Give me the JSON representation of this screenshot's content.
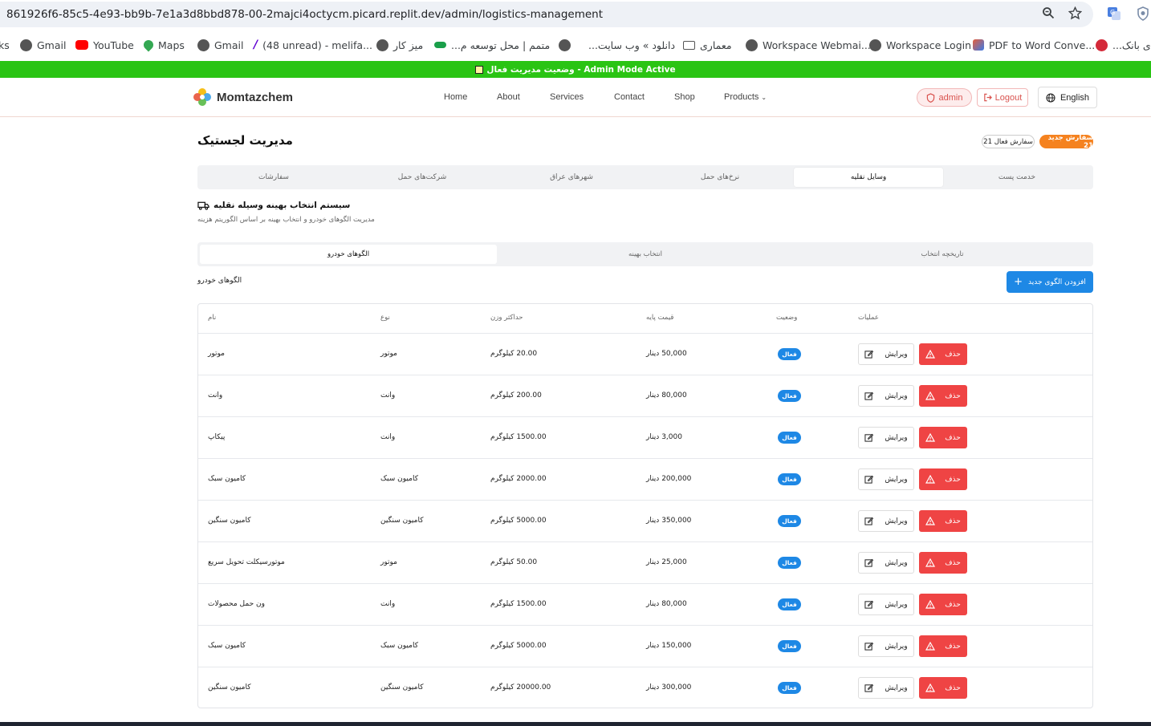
{
  "browser": {
    "url": "861926f6-85c5-4e93-bb9b-7e1a3d8bbd878-00-2majci4octycm.picard.replit.dev/admin/logistics-management",
    "bookmarks": [
      {
        "label": "ks",
        "icon": "none"
      },
      {
        "label": "Gmail",
        "icon": "globe-icon"
      },
      {
        "label": "YouTube",
        "icon": "youtube-icon"
      },
      {
        "label": "Maps",
        "icon": "maps-pin-icon"
      },
      {
        "label": "Gmail",
        "icon": "globe-icon"
      },
      {
        "label": "(48 unread) - melifa...",
        "icon": "yahoo-icon"
      },
      {
        "label": "میز کار",
        "icon": "globe-icon"
      },
      {
        "label": "متمم | محل توسعه م...",
        "icon": "motamem-icon"
      },
      {
        "label": "",
        "icon": "globe-icon"
      },
      {
        "label": "دانلود » وب سایت...",
        "icon": "none"
      },
      {
        "label": "معماری",
        "icon": "folder-icon"
      },
      {
        "label": "Workspace Webmai...",
        "icon": "globe-icon"
      },
      {
        "label": "Workspace Login",
        "icon": "globe-icon"
      },
      {
        "label": "PDF to Word Conve...",
        "icon": "pdf-icon"
      },
      {
        "label": "ی بانک...",
        "icon": "bank-icon"
      }
    ]
  },
  "admin_bar": {
    "text": "وضعیت مدیریت فعال - Admin Mode Active"
  },
  "header": {
    "brand": "Momtazchem",
    "nav": [
      "Home",
      "About",
      "Services",
      "Contact",
      "Shop",
      "Products"
    ],
    "admin_label": "admin",
    "logout_label": "Logout",
    "language_label": "English"
  },
  "page": {
    "title": "مدیریت لجستیک",
    "badge_new": "سفارش جدید 21",
    "badge_active": "سفارش فعال 21",
    "main_tabs": [
      "سفارشات",
      "شرکت‌های حمل",
      "شهرهای عراق",
      "نرخ‌های حمل",
      "وسایل نقلیه",
      "خدمت پست"
    ],
    "active_main_tab": "وسایل نقلیه",
    "section_title": "سیستم انتخاب بهینه وسیله نقلیه",
    "section_subtitle": "مدیریت الگوهای خودرو و انتخاب بهینه بر اساس الگوریتم هزینه",
    "sub_tabs": [
      "الگوهای خودرو",
      "انتخاب بهینه",
      "تاریخچه انتخاب"
    ],
    "active_sub_tab": "الگوهای خودرو",
    "list_label": "الگوهای خودرو",
    "add_button": "افزودن الگوی جدید"
  },
  "table": {
    "headers": {
      "name": "نام",
      "type": "نوع",
      "max_weight": "حداکثر وزن",
      "base_price": "قیمت پایه",
      "status": "وضعیت",
      "actions": "عملیات"
    },
    "edit_label": "ویرایش",
    "delete_label": "حذف",
    "rows": [
      {
        "name": "موتور",
        "type": "موتور",
        "max_weight": "20.00 کیلوگرم",
        "base_price": "50,000 دینار",
        "status": "فعال"
      },
      {
        "name": "وانت",
        "type": "وانت",
        "max_weight": "200.00 کیلوگرم",
        "base_price": "80,000 دینار",
        "status": "فعال"
      },
      {
        "name": "پیکاپ",
        "type": "وانت",
        "max_weight": "1500.00 کیلوگرم",
        "base_price": "3,000 دینار",
        "status": "فعال"
      },
      {
        "name": "کامیون سبک",
        "type": "کامیون سبک",
        "max_weight": "2000.00 کیلوگرم",
        "base_price": "200,000 دینار",
        "status": "فعال"
      },
      {
        "name": "کامیون سنگین",
        "type": "کامیون سنگین",
        "max_weight": "5000.00 کیلوگرم",
        "base_price": "350,000 دینار",
        "status": "فعال"
      },
      {
        "name": "موتورسیکلت تحویل سریع",
        "type": "موتور",
        "max_weight": "50.00 کیلوگرم",
        "base_price": "25,000 دینار",
        "status": "فعال"
      },
      {
        "name": "ون حمل محصولات",
        "type": "وانت",
        "max_weight": "1500.00 کیلوگرم",
        "base_price": "80,000 دینار",
        "status": "فعال"
      },
      {
        "name": "کامیون سبک",
        "type": "کامیون سبک",
        "max_weight": "5000.00 کیلوگرم",
        "base_price": "150,000 دینار",
        "status": "فعال"
      },
      {
        "name": "کامیون سنگین",
        "type": "کامیون سنگین",
        "max_weight": "20000.00 کیلوگرم",
        "base_price": "300,000 دینار",
        "status": "فعال"
      }
    ]
  },
  "colors": {
    "admin_bar": "#2ac414",
    "primary": "#1e88e5",
    "danger": "#ef4444",
    "badge_orange": "#f5821f"
  }
}
